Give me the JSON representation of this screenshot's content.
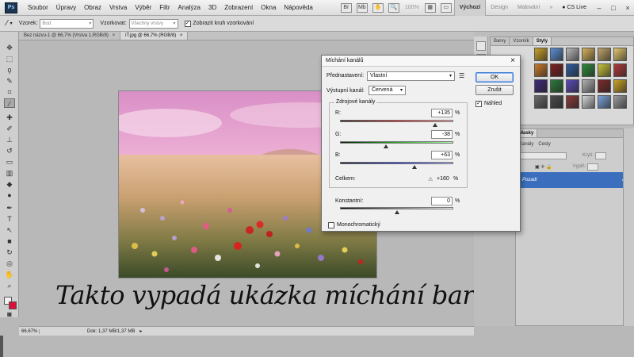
{
  "menubar": {
    "logo": "Ps",
    "items": [
      "Soubor",
      "Úpravy",
      "Obraz",
      "Vrstva",
      "Výběr",
      "Filtr",
      "Analýza",
      "3D",
      "Zobrazení",
      "Okna",
      "Nápověda"
    ],
    "zoom": "100%",
    "workspaces": [
      "Výchozí",
      "Design",
      "Malování"
    ],
    "active_workspace": "Výchozí",
    "more": "»",
    "cs_live": "CS Live",
    "window_buttons": [
      "–",
      "□",
      "×"
    ]
  },
  "options_bar": {
    "sample_label": "Vzorek:",
    "sample_value": "Bod",
    "sampling_label": "Vzorkovat:",
    "sampling_value": "Všechny vrstvy",
    "ring_checkbox_label": "Zobrazit kruh vzorkování",
    "ring_checked": true
  },
  "document_tabs": [
    {
      "label": "Bez názvu-1 @ 66,7% (Vrstva 1,RGB/8)",
      "close": "×"
    },
    {
      "label": "iT.jpg @ 66,7% (RGB/8)",
      "close": "×",
      "active": true
    }
  ],
  "caption": "Takto vypadá ukázka míchání barev",
  "status_bar": {
    "zoom": "66,67%",
    "doc_info": "Dok: 1,37 MB/1,37 MB"
  },
  "styles_panel": {
    "tabs": [
      "Barvy",
      "Vzorník",
      "Styly"
    ],
    "active_tab": "Styly",
    "swatch_colors": [
      "#c9a227",
      "#5a8fd6",
      "#b8b8b8",
      "#d6b25a",
      "#bfa36a",
      "#e3c66e",
      "#c97a2a",
      "#7e1f1f",
      "#2f5c9e",
      "#2e8a3a",
      "#c9c23a",
      "#b03a3a",
      "#3f2a7a",
      "#2a7a3a",
      "#5a4ab8",
      "#b0b0b0",
      "#7a2a2a",
      "#c9a227",
      "#6a6a6a",
      "#4a4a4a",
      "#8a3a3a",
      "#d6d6d6",
      "#7aa0d6",
      "#9a9a9a"
    ]
  },
  "layers_panel": {
    "tabs": [
      "Masky"
    ],
    "sub_tabs": [
      "Kanály",
      "Cesty"
    ],
    "blend_partial": "dky",
    "opacity_label": "Krytí:",
    "fill_label": "Výplň:",
    "layer_name": "Pozadí",
    "lock_icon": "🔒"
  },
  "dialog": {
    "title": "Míchání kanálů",
    "close": "×",
    "preset_label": "Přednastavení:",
    "preset_value": "Vlastní",
    "output_label": "Výstupní kanál:",
    "output_value": "Červená",
    "source_group_label": "Zdrojové kanály",
    "channels": [
      {
        "label": "R:",
        "value": "+135",
        "unit": "%",
        "fraction": 0.8375
      },
      {
        "label": "G:",
        "value": "-38",
        "unit": "%",
        "fraction": 0.405
      },
      {
        "label": "B:",
        "value": "+63",
        "unit": "%",
        "fraction": 0.6575
      }
    ],
    "total_label": "Celkem:",
    "total_value": "+160",
    "total_unit": "%",
    "constant_label": "Konstantní:",
    "constant_value": "0",
    "constant_unit": "%",
    "constant_fraction": 0.5,
    "mono_label": "Monochromatický",
    "mono_checked": false,
    "ok_label": "OK",
    "cancel_label": "Zrušit",
    "preview_label": "Náhled",
    "preview_checked": true,
    "warning_icon": "⚠"
  }
}
